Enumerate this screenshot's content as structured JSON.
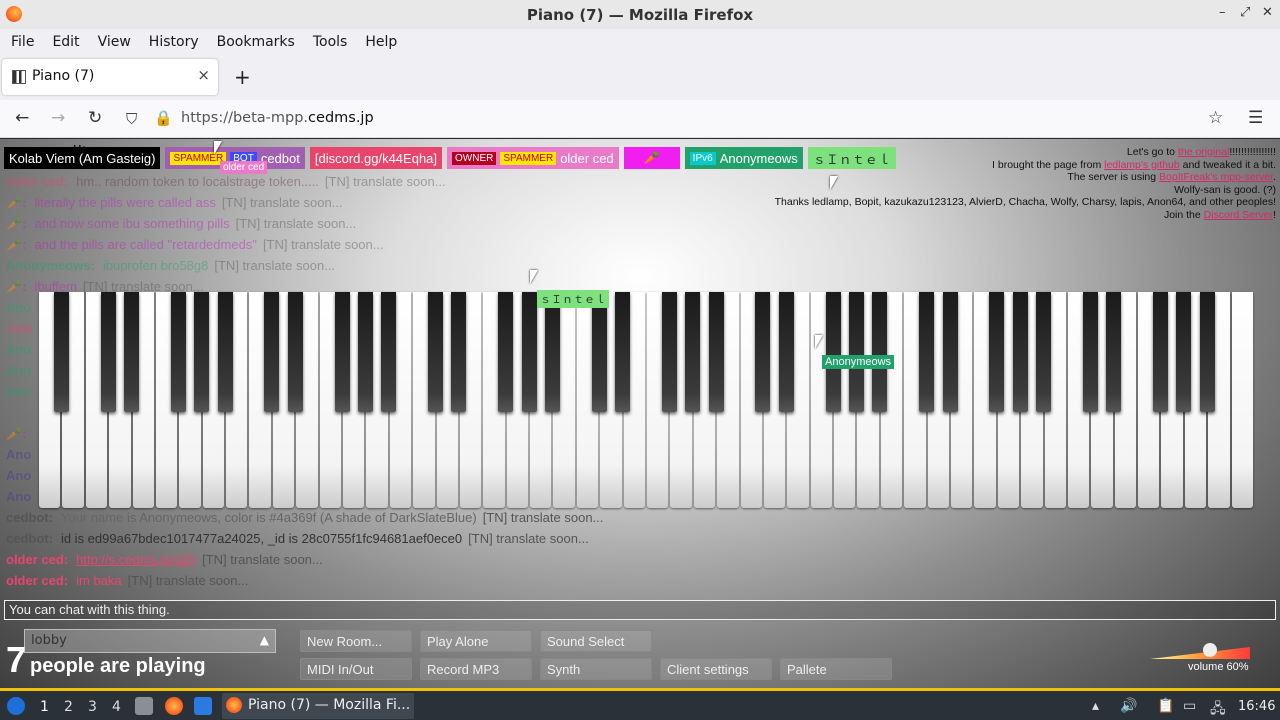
{
  "window": {
    "title": "Piano (7) — Mozilla Firefox",
    "controls": [
      "–",
      "⤢",
      "✕"
    ]
  },
  "menu": [
    "File",
    "Edit",
    "View",
    "History",
    "Bookmarks",
    "Tools",
    "Help"
  ],
  "tab": {
    "label": "Piano (7)",
    "close": "×",
    "new": "+"
  },
  "nav": {
    "url_prefix": "https://beta-mpp.",
    "url_domain": "cedms.jp"
  },
  "players": [
    {
      "name": "Kolab Viem (Am Gasteig)",
      "color": "#000000",
      "tags": []
    },
    {
      "name": "cedbot",
      "color": "#a05fb1",
      "tags": [
        {
          "t": "SPAMMER",
          "c": "#ffe600"
        },
        {
          "t": "BOT",
          "c": "#3b4cff"
        }
      ]
    },
    {
      "name": "[discord.gg/k44Eqha]",
      "color": "#e8456c",
      "tags": []
    },
    {
      "name": "older ced",
      "color": "#e87ac8",
      "tags": [
        {
          "t": "OWNER",
          "c": "#b30020"
        },
        {
          "t": "SPAMMER",
          "c": "#ffe600"
        }
      ]
    },
    {
      "name": "🥕",
      "color": "#f01ff0",
      "tags": []
    },
    {
      "name": "Anonymeows",
      "color": "#23a16c",
      "tags": [
        {
          "t": "IPv6",
          "c": "#0ac9c9"
        }
      ]
    },
    {
      "name": "ｓＩｎｔｅｌ",
      "color": "#7de27d",
      "tags": []
    }
  ],
  "credits": {
    "l1a": "Let's go to ",
    "l1link": "the original",
    "l1b": "!!!!!!!!!!!!!!!!",
    "l2a": "I brought the page from ",
    "l2link": "ledlamp's github",
    "l2b": " and tweaked it a bit.",
    "l3a": "The server is using ",
    "l3link": "BopItFreak's mpp-server",
    "l3b": ".",
    "l4": "Wolfy-san is good. (?)",
    "l5": "Thanks ledlamp, Bopit, kazukazu123123, AlvierD, Chacha, Wolfy, Charsy, lapis, Anon64, and other peoples!",
    "l6a": "Join the ",
    "l6link": "Discord Server",
    "l6b": "!"
  },
  "chat_top": [
    {
      "name": "older ced:",
      "color": "#e8456c",
      "msg": "hm.. random token to localstrage token.....",
      "tr": "[TN] translate soon..."
    },
    {
      "name": "🥕:",
      "color": "#c01fc0",
      "msg": "literally the pills were called ass",
      "tr": "[TN] translate soon..."
    },
    {
      "name": "🥕:",
      "color": "#c01fc0",
      "msg": "and now some ibu something pills",
      "tr": "[TN] translate soon..."
    },
    {
      "name": "🥕:",
      "color": "#c01fc0",
      "msg": "and the pills are called \"retardedmeds\"",
      "tr": "[TN] translate soon..."
    },
    {
      "name": "Anonymeows:",
      "color": "#23a16c",
      "msg": "ibuprofen bro58g8",
      "tr": "[TN] translate soon..."
    },
    {
      "name": "🥕:",
      "color": "#c01fc0",
      "msg": "ibuffem",
      "tr": "[TN] translate soon..."
    }
  ],
  "chat_side": [
    "Ano",
    "olde",
    "Ano",
    "Ano",
    "Ano",
    "🥕:",
    "Ano",
    "Ano",
    "Ano"
  ],
  "chat_bottom": [
    {
      "name": "cedbot:",
      "color": "#555555",
      "msg": "Your name is Anonymeows, color is #4a369f (A shade of DarkSlateBlue)",
      "tr": "[TN] translate soon..."
    },
    {
      "name": "cedbot:",
      "color": "#555555",
      "msg": "id is ed99a67bdec1017477a24025, _id is 28c0755f1fc94681aef0ece0",
      "tr": "[TN] translate soon..."
    },
    {
      "name": "older ced:",
      "color": "#e8456c",
      "msg": "http://s.cedms.jp/g2h",
      "tr": "[TN] translate soon..."
    },
    {
      "name": "older ced:",
      "color": "#e8456c",
      "msg": "im baka",
      "tr": "[TN] translate soon..."
    }
  ],
  "cursors": {
    "me": "Me",
    "older": "older ced",
    "sintel": "ｓＩｎｔｅｌ",
    "anon": "Anonymeows"
  },
  "chat_input_placeholder": "You can chat with this thing.",
  "room": {
    "name": "lobby",
    "arrow": "▲"
  },
  "people": {
    "count": "7",
    "text": "people are playing"
  },
  "buttons": {
    "new_room": "New Room...",
    "play_alone": "Play Alone",
    "sound_select": "Sound Select",
    "midi": "MIDI In/Out",
    "record": "Record MP3",
    "synth": "Synth",
    "client_settings": "Client settings",
    "pallete": "Pallete"
  },
  "volume": {
    "label": "volume 60%",
    "level": 0.6
  },
  "taskbar": {
    "workspaces": [
      "1",
      "2",
      "3",
      "4"
    ],
    "task_label": "Piano (7) — Mozilla Fi...",
    "clock": "16:46"
  }
}
